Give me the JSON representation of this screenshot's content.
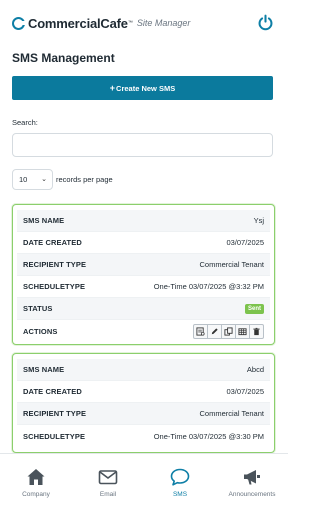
{
  "header": {
    "brand": "CommercialCafe",
    "trademark": "™",
    "subtitle": "Site Manager"
  },
  "page_title": "SMS Management",
  "create_button_label": "Create New SMS",
  "search": {
    "label": "Search:",
    "value": "",
    "placeholder": ""
  },
  "pagination": {
    "per_page_value": "10",
    "per_page_label": "records per page"
  },
  "records": [
    {
      "sms_name_key": "SMS NAME",
      "sms_name": "Ysj",
      "date_created_key": "DATE CREATED",
      "date_created": "03/07/2025",
      "recipient_type_key": "RECIPIENT TYPE",
      "recipient_type": "Commercial Tenant",
      "schedule_type_key": "SCHEDULETYPE",
      "schedule_type": "One-Time 03/07/2025 @3:32 PM",
      "status_key": "STATUS",
      "status": "Sent",
      "actions_key": "ACTIONS"
    },
    {
      "sms_name_key": "SMS NAME",
      "sms_name": "Abcd",
      "date_created_key": "DATE CREATED",
      "date_created": "03/07/2025",
      "recipient_type_key": "RECIPIENT TYPE",
      "recipient_type": "Commercial Tenant",
      "schedule_type_key": "SCHEDULETYPE",
      "schedule_type": "One-Time 03/07/2025 @3:30 PM"
    }
  ],
  "action_icons": [
    "view-icon",
    "edit-icon",
    "copy-icon",
    "table-icon",
    "delete-icon"
  ],
  "bottom_nav": [
    {
      "label": "Company",
      "icon": "home-icon",
      "active": false
    },
    {
      "label": "Email",
      "icon": "envelope-icon",
      "active": false
    },
    {
      "label": "SMS",
      "icon": "chat-bubble-icon",
      "active": true
    },
    {
      "label": "Announcements",
      "icon": "megaphone-icon",
      "active": false
    }
  ],
  "colors": {
    "primary": "#0b7a9d",
    "accent": "#0e7fa6",
    "card_border": "#8ccf6c",
    "status_sent": "#7cc34d"
  }
}
